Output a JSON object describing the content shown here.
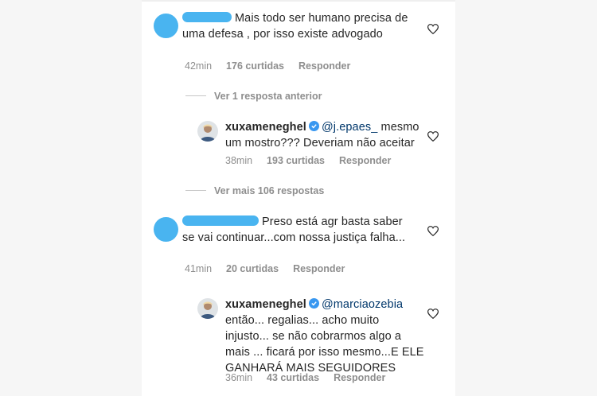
{
  "comments": [
    {
      "text": "Mais todo ser humano precisa de uma defesa , por isso existe advogado",
      "time": "42min",
      "likes": "176 curtidas",
      "reply_label": "Responder",
      "view_replies": "Ver 1 resposta anterior",
      "reply": {
        "username": "xuxameneghel",
        "mention": "@j.epaes_",
        "text": "mesmo um mostro??? Deveriam não aceitar",
        "time": "38min",
        "likes": "193 curtidas",
        "reply_label": "Responder"
      },
      "view_more": "Ver mais 106 respostas"
    },
    {
      "text": "Preso está agr basta saber se vai continuar...com nossa justiça falha...",
      "time": "41min",
      "likes": "20 curtidas",
      "reply_label": "Responder",
      "reply": {
        "username": "xuxameneghel",
        "mention": "@marciaozebia",
        "text": "então... regalias... acho muito injusto... se não cobrarmos algo a mais ... ficará por isso mesmo...E ELE GANHARÁ MAIS SEGUIDORES",
        "time": "36min",
        "likes": "43 curtidas",
        "reply_label": "Responder"
      }
    }
  ],
  "icons": {
    "like": "heart-icon",
    "verified": "verified-badge-icon",
    "avatar_blank": "blurred-avatar",
    "avatar_user": "user-avatar"
  },
  "colors": {
    "blur": "#49b4f0",
    "muted": "#8e8e8e",
    "mention": "#00376b",
    "verified": "#3897f0"
  }
}
